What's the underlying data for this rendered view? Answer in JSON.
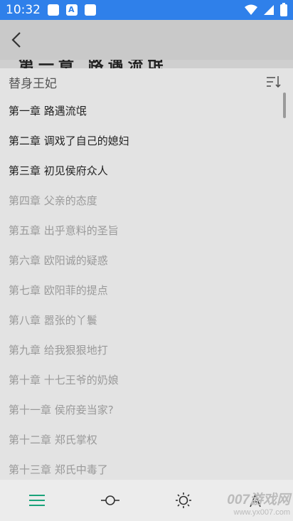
{
  "status_bar": {
    "time": "10:32"
  },
  "chapter_peek": "第一章 路遇流氓",
  "toc": {
    "book_title": "替身王妃",
    "chapters": [
      {
        "title": "第一章 路遇流氓",
        "read": true
      },
      {
        "title": "第二章 调戏了自己的媳妇",
        "read": true
      },
      {
        "title": "第三章 初见侯府众人",
        "read": true
      },
      {
        "title": "第四章 父亲的态度",
        "read": false
      },
      {
        "title": "第五章 出乎意料的圣旨",
        "read": false
      },
      {
        "title": "第六章 欧阳诚的疑惑",
        "read": false
      },
      {
        "title": "第七章 欧阳菲的提点",
        "read": false
      },
      {
        "title": "第八章 嚣张的丫鬟",
        "read": false
      },
      {
        "title": "第九章  给我狠狠地打",
        "read": false
      },
      {
        "title": "第十章 十七王爷的奶娘",
        "read": false
      },
      {
        "title": "第十一章 侯府妾当家?",
        "read": false
      },
      {
        "title": "第十二章 郑氏掌权",
        "read": false
      },
      {
        "title": "第十三章 郑氏中毒了",
        "read": false
      }
    ]
  },
  "colors": {
    "status_bar": "#2f80ea",
    "accent": "#1aa37a"
  },
  "watermark": {
    "brand": "007游戏网",
    "url": "www.yx007.com"
  }
}
